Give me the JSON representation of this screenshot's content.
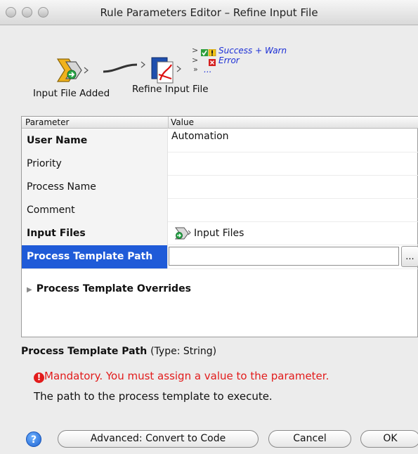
{
  "window": {
    "title": "Rule Parameters Editor – Refine Input File"
  },
  "workflow": {
    "source_node": {
      "label": "Input File Added",
      "icon": "input-file-added-icon"
    },
    "target_node": {
      "label": "Refine Input File",
      "icon": "refine-input-file-icon"
    },
    "outputs": [
      {
        "label": "Success + Warn",
        "icon": "success-warn-icon"
      },
      {
        "label": "Error",
        "icon": "error-icon"
      },
      {
        "label": "...",
        "icon": "more-icon"
      }
    ]
  },
  "table": {
    "headers": {
      "parameter": "Parameter",
      "value": "Value"
    },
    "rows": [
      {
        "parameter": "User Name",
        "value": "Automation",
        "bold": true
      },
      {
        "parameter": "Priority",
        "value": ""
      },
      {
        "parameter": "Process Name",
        "value": ""
      },
      {
        "parameter": "Comment",
        "value": ""
      },
      {
        "parameter": "Input Files",
        "value": "Input Files",
        "bold": true
      },
      {
        "parameter": "Process Template Path",
        "value": "",
        "selected": true
      }
    ],
    "browse_label": "...",
    "group": {
      "label": "Process Template Overrides"
    }
  },
  "info": {
    "param_name": "Process Template Path",
    "param_type": "(Type: String)",
    "error": "Mandatory. You must assign a value to the parameter.",
    "description": "The path to the process template to execute."
  },
  "buttons": {
    "help": "?",
    "advanced": "Advanced: Convert to Code",
    "cancel": "Cancel",
    "ok": "OK"
  },
  "colors": {
    "selection": "#1f5bd8",
    "error": "#e21b1b",
    "output_link": "#1c2fd6"
  }
}
